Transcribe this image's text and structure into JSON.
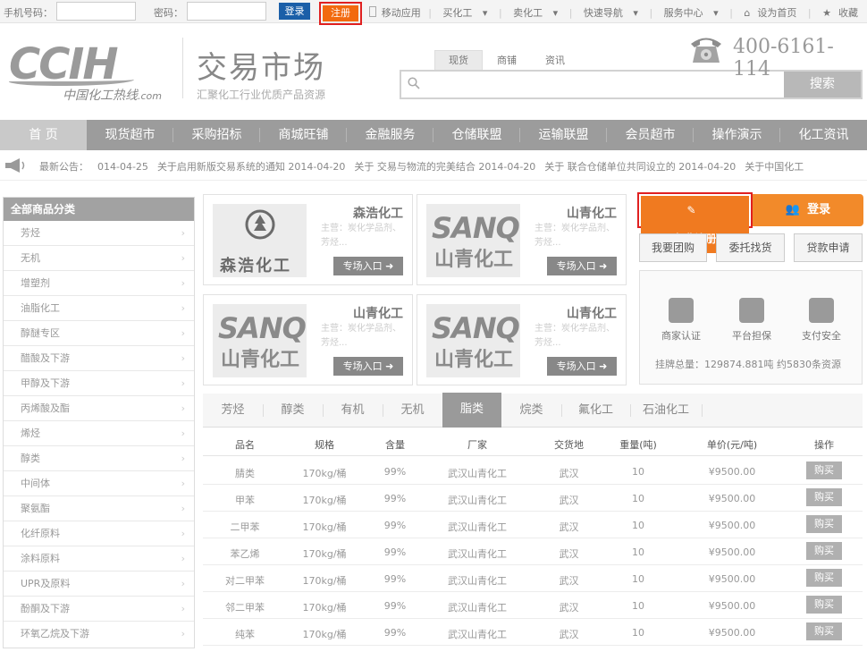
{
  "topbar": {
    "phone_label": "手机号码：",
    "password_label": "密码：",
    "login_btn": "登录",
    "register_btn": "注册",
    "links": [
      "移动应用",
      "买化工",
      "卖化工",
      "快速导航",
      "服务中心",
      "设为首页",
      "收藏"
    ]
  },
  "header": {
    "logo_big": "CCIH",
    "logo_cn": "中国化工热线",
    "logo_suffix": ".com",
    "title": "交易市场",
    "subtitle": "汇聚化工行业优质产品资源",
    "search_tabs": [
      "现货",
      "商铺",
      "资讯"
    ],
    "search_btn": "搜索",
    "phone": "400-6161-114"
  },
  "nav": [
    "首 页",
    "现货超市",
    "采购招标",
    "商城旺铺",
    "金融服务",
    "仓储联盟",
    "运输联盟",
    "会员超市",
    "操作演示",
    "化工资讯"
  ],
  "news": {
    "label": "最新公告：",
    "items": [
      "014-04-25",
      "关于启用新版交易系统的通知 2014-04-20",
      "关于 交易与物流的完美结合 2014-04-20",
      "关于 联合仓储单位共同设立的 2014-04-20",
      "关于中国化工"
    ]
  },
  "sidebar": {
    "title": "全部商品分类",
    "items": [
      "芳烃",
      "无机",
      "增塑剂",
      "油脂化工",
      "醇醚专区",
      "醋酸及下游",
      "甲醇及下游",
      "丙烯酸及酯",
      "烯烃",
      "醇类",
      "中间体",
      "聚氨酯",
      "化纤原料",
      "涂料原料",
      "UPR及原料",
      "酚酮及下游",
      "环氧乙烷及下游"
    ]
  },
  "cards": [
    {
      "name": "森浩化工",
      "desc": "主营：炭化学品剂、芳烃...",
      "enter": "专场入口 ➜",
      "logo_cn": "森浩化工"
    },
    {
      "name": "山青化工",
      "desc": "主营：炭化学品剂、芳烃...",
      "enter": "专场入口 ➜",
      "logo_en": "SANQ",
      "logo_cn": "山青化工"
    },
    {
      "name": "山青化工",
      "desc": "主营：炭化学品剂、芳烃...",
      "enter": "专场入口 ➜",
      "logo_en": "SANQ",
      "logo_cn": "山青化工"
    },
    {
      "name": "山青化工",
      "desc": "主营：炭化学品剂、芳烃...",
      "enter": "专场入口 ➜",
      "logo_en": "SANQ",
      "logo_cn": "山青化工"
    }
  ],
  "right": {
    "free_register": "免费注册",
    "login": "登录",
    "group_buy": "我要团购",
    "entrust": "委托找货",
    "loan": "贷款申请",
    "trust": [
      "商家认证",
      "平台担保",
      "支付安全"
    ],
    "total_label": "挂牌总量：",
    "total_value": "129874.881吨",
    "total_res": "约5830条资源"
  },
  "product_tabs": [
    "芳烃",
    "醇类",
    "有机",
    "无机",
    "脂类",
    "烷类",
    "氟化工",
    "石油化工"
  ],
  "table": {
    "headers": [
      "品名",
      "规格",
      "含量",
      "厂家",
      "交货地",
      "重量(吨)",
      "单价(元/吨)",
      "操作"
    ],
    "rows": [
      [
        "腈类",
        "170kg/桶",
        "99%",
        "武汉山青化工",
        "武汉",
        "10",
        "¥9500.00",
        "购买"
      ],
      [
        "甲苯",
        "170kg/桶",
        "99%",
        "武汉山青化工",
        "武汉",
        "10",
        "¥9500.00",
        "购买"
      ],
      [
        "二甲苯",
        "170kg/桶",
        "99%",
        "武汉山青化工",
        "武汉",
        "10",
        "¥9500.00",
        "购买"
      ],
      [
        "苯乙烯",
        "170kg/桶",
        "99%",
        "武汉山青化工",
        "武汉",
        "10",
        "¥9500.00",
        "购买"
      ],
      [
        "对二甲苯",
        "170kg/桶",
        "99%",
        "武汉山青化工",
        "武汉",
        "10",
        "¥9500.00",
        "购买"
      ],
      [
        "邻二甲苯",
        "170kg/桶",
        "99%",
        "武汉山青化工",
        "武汉",
        "10",
        "¥9500.00",
        "购买"
      ],
      [
        "纯苯",
        "170kg/桶",
        "99%",
        "武汉山青化工",
        "武汉",
        "10",
        "¥9500.00",
        "购买"
      ]
    ]
  }
}
